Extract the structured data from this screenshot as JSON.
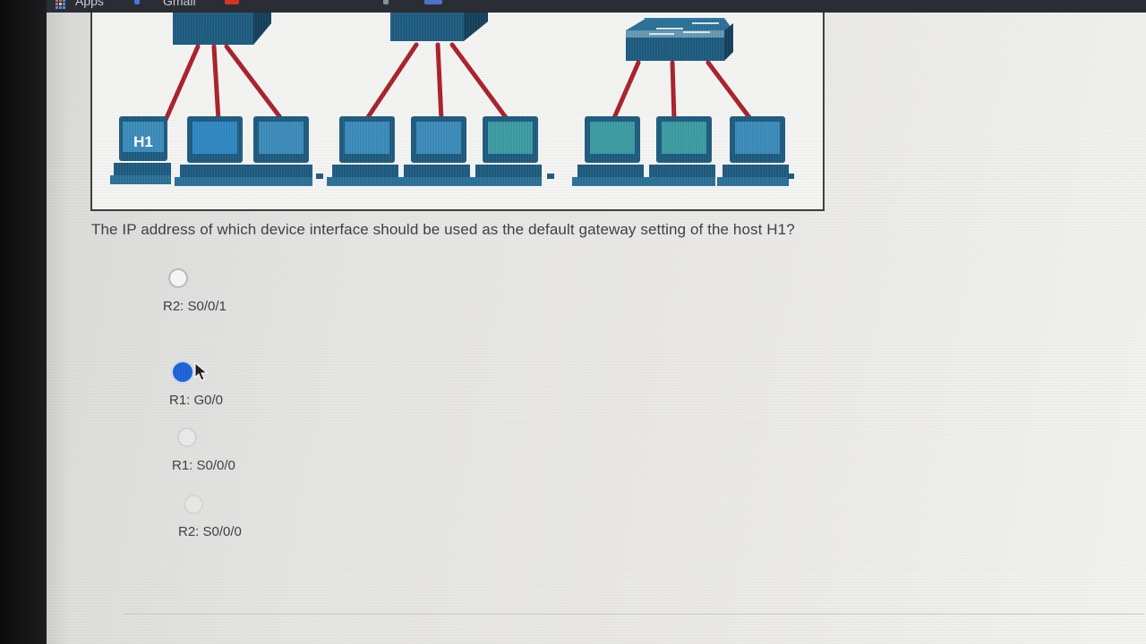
{
  "browser": {
    "bookmarks": [
      "Apps",
      "Gmail"
    ]
  },
  "diagram": {
    "host_label": "H1",
    "icons": [
      "router-icon",
      "switch-icon",
      "pc-icon"
    ]
  },
  "quiz": {
    "question": "The IP address of which device interface should be used as the default gateway setting of the host H1?",
    "options": [
      {
        "label": "R2: S0/0/1",
        "selected": false
      },
      {
        "label": "R1: G0/0",
        "selected": true
      },
      {
        "label": "R1: S0/0/0",
        "selected": false
      },
      {
        "label": "R2: S0/0/0",
        "selected": false
      }
    ]
  },
  "colors": {
    "radio_selected": "#1a62d6",
    "cable": "#a8202a",
    "device": "#1d5a7e",
    "text": "#3c3c40"
  }
}
